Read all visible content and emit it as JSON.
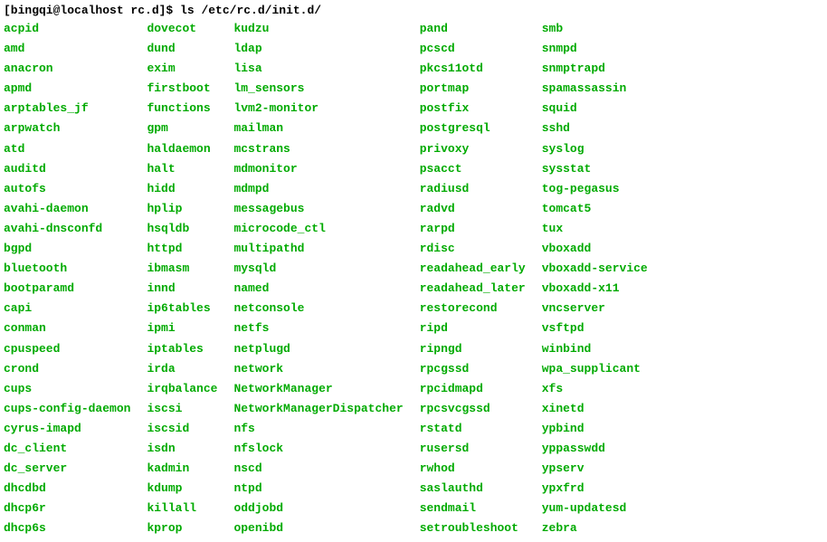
{
  "prompt": {
    "user_host_dir": "[bingqi@localhost rc.d]$",
    "command": "ls /etc/rc.d/init.d/"
  },
  "columns": [
    [
      "acpid",
      "amd",
      "anacron",
      "apmd",
      "arptables_jf",
      "arpwatch",
      "atd",
      "auditd",
      "autofs",
      "avahi-daemon",
      "avahi-dnsconfd",
      "bgpd",
      "bluetooth",
      "bootparamd",
      "capi",
      "conman",
      "cpuspeed",
      "crond",
      "cups",
      "cups-config-daemon",
      "cyrus-imapd",
      "dc_client",
      "dc_server",
      "dhcdbd",
      "dhcp6r",
      "dhcp6s"
    ],
    [
      "dovecot",
      "dund",
      "exim",
      "firstboot",
      "functions",
      "gpm",
      "haldaemon",
      "halt",
      "hidd",
      "hplip",
      "hsqldb",
      "httpd",
      "ibmasm",
      "innd",
      "ip6tables",
      "ipmi",
      "iptables",
      "irda",
      "irqbalance",
      "iscsi",
      "iscsid",
      "isdn",
      "kadmin",
      "kdump",
      "killall",
      "kprop"
    ],
    [
      "kudzu",
      "ldap",
      "lisa",
      "lm_sensors",
      "lvm2-monitor",
      "mailman",
      "mcstrans",
      "mdmonitor",
      "mdmpd",
      "messagebus",
      "microcode_ctl",
      "multipathd",
      "mysqld",
      "named",
      "netconsole",
      "netfs",
      "netplugd",
      "network",
      "NetworkManager",
      "NetworkManagerDispatcher",
      "nfs",
      "nfslock",
      "nscd",
      "ntpd",
      "oddjobd",
      "openibd"
    ],
    [
      "pand",
      "pcscd",
      "pkcs11otd",
      "portmap",
      "postfix",
      "postgresql",
      "privoxy",
      "psacct",
      "radiusd",
      "radvd",
      "rarpd",
      "rdisc",
      "readahead_early",
      "readahead_later",
      "restorecond",
      "ripd",
      "ripngd",
      "rpcgssd",
      "rpcidmapd",
      "rpcsvcgssd",
      "rstatd",
      "rusersd",
      "rwhod",
      "saslauthd",
      "sendmail",
      "setroubleshoot"
    ],
    [
      "smb",
      "snmpd",
      "snmptrapd",
      "spamassassin",
      "squid",
      "sshd",
      "syslog",
      "sysstat",
      "tog-pegasus",
      "tomcat5",
      "tux",
      "vboxadd",
      "vboxadd-service",
      "vboxadd-x11",
      "vncserver",
      "vsftpd",
      "winbind",
      "wpa_supplicant",
      "xfs",
      "xinetd",
      "ypbind",
      "yppasswdd",
      "ypserv",
      "ypxfrd",
      "yum-updatesd",
      "zebra"
    ]
  ]
}
